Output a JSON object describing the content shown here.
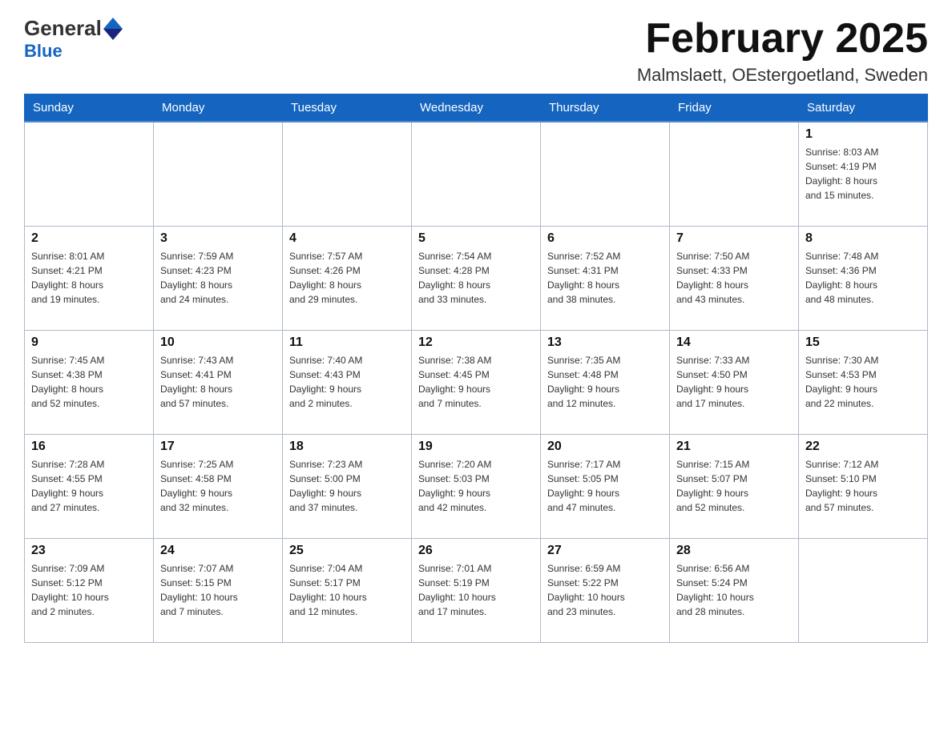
{
  "header": {
    "logo_general": "General",
    "logo_blue": "Blue",
    "month_title": "February 2025",
    "location": "Malmslaett, OEstergoetland, Sweden"
  },
  "weekdays": [
    "Sunday",
    "Monday",
    "Tuesday",
    "Wednesday",
    "Thursday",
    "Friday",
    "Saturday"
  ],
  "weeks": [
    [
      {
        "day": "",
        "info": ""
      },
      {
        "day": "",
        "info": ""
      },
      {
        "day": "",
        "info": ""
      },
      {
        "day": "",
        "info": ""
      },
      {
        "day": "",
        "info": ""
      },
      {
        "day": "",
        "info": ""
      },
      {
        "day": "1",
        "info": "Sunrise: 8:03 AM\nSunset: 4:19 PM\nDaylight: 8 hours\nand 15 minutes."
      }
    ],
    [
      {
        "day": "2",
        "info": "Sunrise: 8:01 AM\nSunset: 4:21 PM\nDaylight: 8 hours\nand 19 minutes."
      },
      {
        "day": "3",
        "info": "Sunrise: 7:59 AM\nSunset: 4:23 PM\nDaylight: 8 hours\nand 24 minutes."
      },
      {
        "day": "4",
        "info": "Sunrise: 7:57 AM\nSunset: 4:26 PM\nDaylight: 8 hours\nand 29 minutes."
      },
      {
        "day": "5",
        "info": "Sunrise: 7:54 AM\nSunset: 4:28 PM\nDaylight: 8 hours\nand 33 minutes."
      },
      {
        "day": "6",
        "info": "Sunrise: 7:52 AM\nSunset: 4:31 PM\nDaylight: 8 hours\nand 38 minutes."
      },
      {
        "day": "7",
        "info": "Sunrise: 7:50 AM\nSunset: 4:33 PM\nDaylight: 8 hours\nand 43 minutes."
      },
      {
        "day": "8",
        "info": "Sunrise: 7:48 AM\nSunset: 4:36 PM\nDaylight: 8 hours\nand 48 minutes."
      }
    ],
    [
      {
        "day": "9",
        "info": "Sunrise: 7:45 AM\nSunset: 4:38 PM\nDaylight: 8 hours\nand 52 minutes."
      },
      {
        "day": "10",
        "info": "Sunrise: 7:43 AM\nSunset: 4:41 PM\nDaylight: 8 hours\nand 57 minutes."
      },
      {
        "day": "11",
        "info": "Sunrise: 7:40 AM\nSunset: 4:43 PM\nDaylight: 9 hours\nand 2 minutes."
      },
      {
        "day": "12",
        "info": "Sunrise: 7:38 AM\nSunset: 4:45 PM\nDaylight: 9 hours\nand 7 minutes."
      },
      {
        "day": "13",
        "info": "Sunrise: 7:35 AM\nSunset: 4:48 PM\nDaylight: 9 hours\nand 12 minutes."
      },
      {
        "day": "14",
        "info": "Sunrise: 7:33 AM\nSunset: 4:50 PM\nDaylight: 9 hours\nand 17 minutes."
      },
      {
        "day": "15",
        "info": "Sunrise: 7:30 AM\nSunset: 4:53 PM\nDaylight: 9 hours\nand 22 minutes."
      }
    ],
    [
      {
        "day": "16",
        "info": "Sunrise: 7:28 AM\nSunset: 4:55 PM\nDaylight: 9 hours\nand 27 minutes."
      },
      {
        "day": "17",
        "info": "Sunrise: 7:25 AM\nSunset: 4:58 PM\nDaylight: 9 hours\nand 32 minutes."
      },
      {
        "day": "18",
        "info": "Sunrise: 7:23 AM\nSunset: 5:00 PM\nDaylight: 9 hours\nand 37 minutes."
      },
      {
        "day": "19",
        "info": "Sunrise: 7:20 AM\nSunset: 5:03 PM\nDaylight: 9 hours\nand 42 minutes."
      },
      {
        "day": "20",
        "info": "Sunrise: 7:17 AM\nSunset: 5:05 PM\nDaylight: 9 hours\nand 47 minutes."
      },
      {
        "day": "21",
        "info": "Sunrise: 7:15 AM\nSunset: 5:07 PM\nDaylight: 9 hours\nand 52 minutes."
      },
      {
        "day": "22",
        "info": "Sunrise: 7:12 AM\nSunset: 5:10 PM\nDaylight: 9 hours\nand 57 minutes."
      }
    ],
    [
      {
        "day": "23",
        "info": "Sunrise: 7:09 AM\nSunset: 5:12 PM\nDaylight: 10 hours\nand 2 minutes."
      },
      {
        "day": "24",
        "info": "Sunrise: 7:07 AM\nSunset: 5:15 PM\nDaylight: 10 hours\nand 7 minutes."
      },
      {
        "day": "25",
        "info": "Sunrise: 7:04 AM\nSunset: 5:17 PM\nDaylight: 10 hours\nand 12 minutes."
      },
      {
        "day": "26",
        "info": "Sunrise: 7:01 AM\nSunset: 5:19 PM\nDaylight: 10 hours\nand 17 minutes."
      },
      {
        "day": "27",
        "info": "Sunrise: 6:59 AM\nSunset: 5:22 PM\nDaylight: 10 hours\nand 23 minutes."
      },
      {
        "day": "28",
        "info": "Sunrise: 6:56 AM\nSunset: 5:24 PM\nDaylight: 10 hours\nand 28 minutes."
      },
      {
        "day": "",
        "info": ""
      }
    ]
  ]
}
